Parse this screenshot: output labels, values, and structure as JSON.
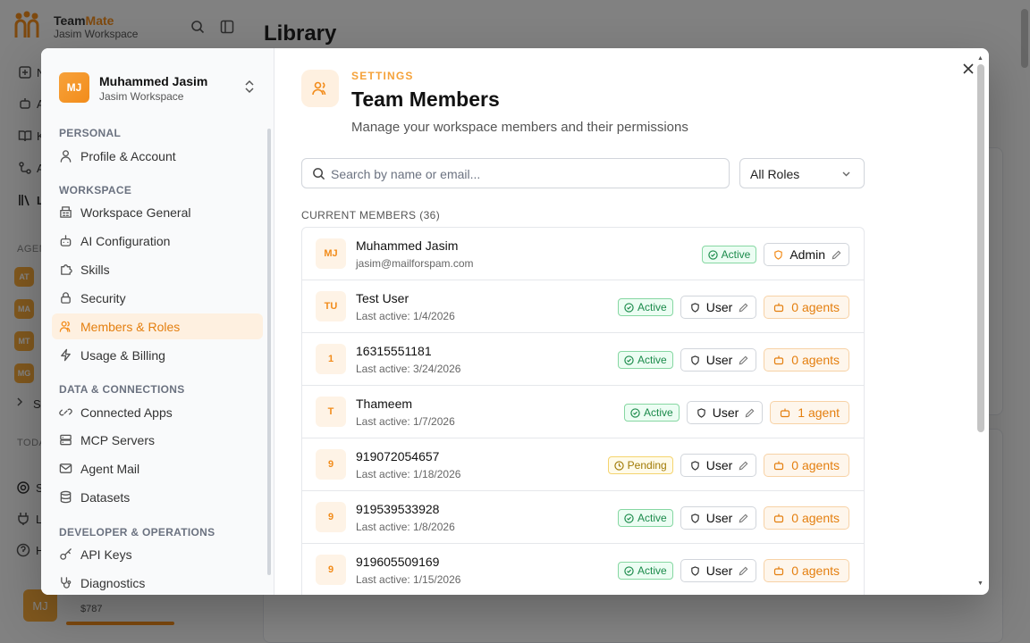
{
  "background": {
    "brand_part1": "Team",
    "brand_part2": "Mate",
    "brand_workspace": "Jasim Workspace",
    "page_title": "Library",
    "nav_letters": [
      "N",
      "A",
      "K",
      "A",
      "L"
    ],
    "agents_section": "AGEN",
    "agent_badges": [
      "AT",
      "MA",
      "MT",
      "MG"
    ],
    "more_letter": "S",
    "today_section": "TODA",
    "bottom_nav_letters": [
      "S",
      "L",
      "H"
    ],
    "bottom_avatar": "MJ",
    "credits": "$787",
    "credit_fraction": 0.6
  },
  "modal": {
    "sidebar": {
      "user_initials": "MJ",
      "user_name": "Muhammed Jasim",
      "user_workspace": "Jasim Workspace",
      "sections": [
        {
          "title": "PERSONAL",
          "items": [
            {
              "label": "Profile & Account",
              "icon": "user-icon",
              "active": false
            }
          ]
        },
        {
          "title": "WORKSPACE",
          "items": [
            {
              "label": "Workspace General",
              "icon": "building-icon",
              "active": false
            },
            {
              "label": "AI Configuration",
              "icon": "bot-icon",
              "active": false
            },
            {
              "label": "Skills",
              "icon": "puzzle-icon",
              "active": false
            },
            {
              "label": "Security",
              "icon": "lock-icon",
              "active": false
            },
            {
              "label": "Members & Roles",
              "icon": "users-icon",
              "active": true
            },
            {
              "label": "Usage & Billing",
              "icon": "lightning-icon",
              "active": false
            }
          ]
        },
        {
          "title": "DATA & CONNECTIONS",
          "items": [
            {
              "label": "Connected Apps",
              "icon": "link-icon",
              "active": false
            },
            {
              "label": "MCP Servers",
              "icon": "server-icon",
              "active": false
            },
            {
              "label": "Agent Mail",
              "icon": "mail-icon",
              "active": false
            },
            {
              "label": "Datasets",
              "icon": "database-icon",
              "active": false
            }
          ]
        },
        {
          "title": "DEVELOPER & OPERATIONS",
          "items": [
            {
              "label": "API Keys",
              "icon": "key-icon",
              "active": false
            },
            {
              "label": "Diagnostics",
              "icon": "stethoscope-icon",
              "active": false
            }
          ]
        }
      ]
    },
    "header": {
      "kicker": "SETTINGS",
      "title": "Team Members",
      "description": "Manage your workspace members and their permissions"
    },
    "search": {
      "placeholder": "Search by name or email...",
      "value": ""
    },
    "role_filter": {
      "selected": "All Roles"
    },
    "members_title": "CURRENT MEMBERS (36)",
    "members": [
      {
        "initials": "MJ",
        "name": "Muhammed Jasim",
        "sub": "jasim@mailforspam.com",
        "status": "Active",
        "role": "Admin",
        "agents": ""
      },
      {
        "initials": "TU",
        "name": "Test User",
        "sub": "Last active: 1/4/2026",
        "status": "Active",
        "role": "User",
        "agents": "0 agents"
      },
      {
        "initials": "1",
        "name": "16315551181",
        "sub": "Last active: 3/24/2026",
        "status": "Active",
        "role": "User",
        "agents": "0 agents"
      },
      {
        "initials": "T",
        "name": "Thameem",
        "sub": "Last active: 1/7/2026",
        "status": "Active",
        "role": "User",
        "agents": "1 agent"
      },
      {
        "initials": "9",
        "name": "919072054657",
        "sub": "Last active: 1/18/2026",
        "status": "Pending",
        "role": "User",
        "agents": "0 agents"
      },
      {
        "initials": "9",
        "name": "919539533928",
        "sub": "Last active: 1/8/2026",
        "status": "Active",
        "role": "User",
        "agents": "0 agents"
      },
      {
        "initials": "9",
        "name": "919605509169",
        "sub": "Last active: 1/15/2026",
        "status": "Active",
        "role": "User",
        "agents": "0 agents"
      }
    ],
    "colors": {
      "accent": "#f28c1b",
      "active_green": "#1a8a4a",
      "pending_yellow": "#a07a05"
    }
  }
}
